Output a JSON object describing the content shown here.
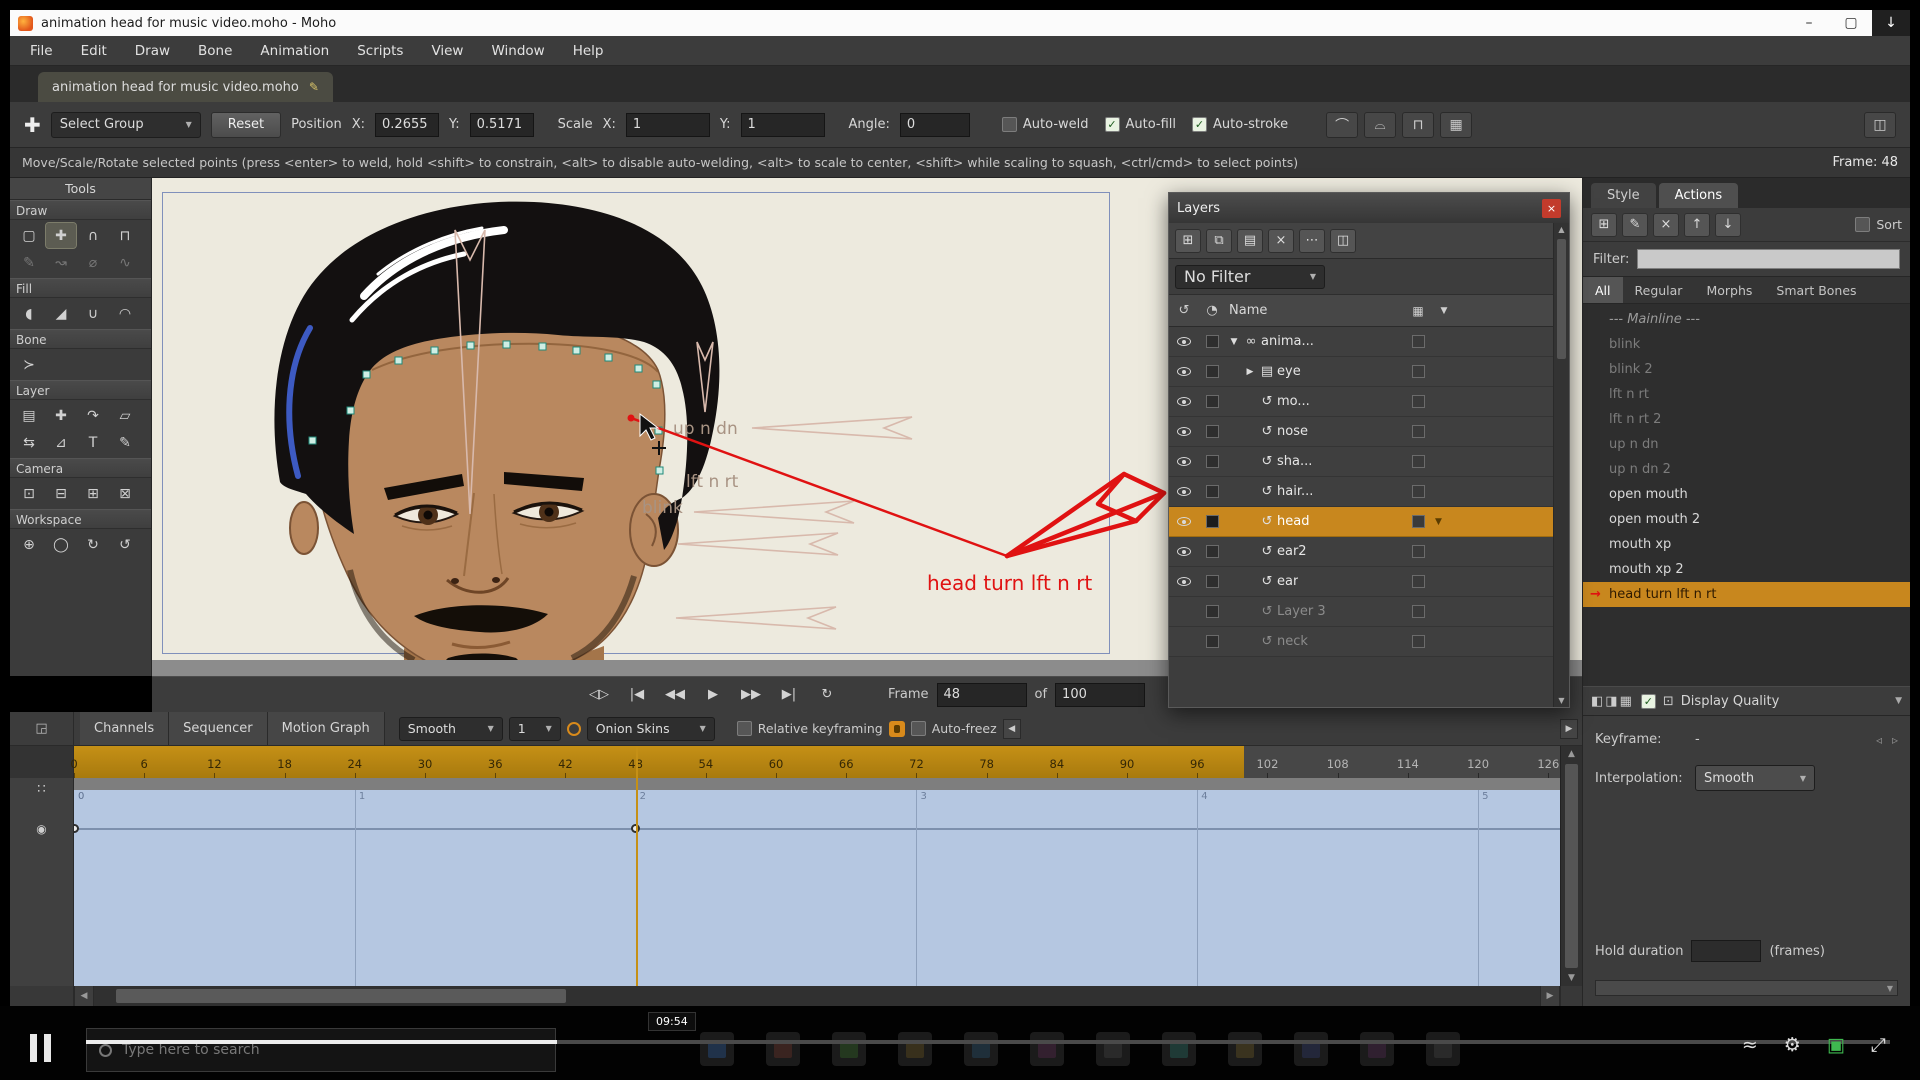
{
  "window": {
    "title": "animation head for music video.moho - Moho",
    "controls": {
      "minimize": "–",
      "maximize": "▢",
      "download": "↓"
    }
  },
  "colors": {
    "accent_orange": "#c8871e",
    "selection_red": "#e01212",
    "timeline_blue": "#b5c7e1",
    "canvas_cream": "#edeade"
  },
  "menu": {
    "items": [
      "File",
      "Edit",
      "Draw",
      "Bone",
      "Animation",
      "Scripts",
      "View",
      "Window",
      "Help"
    ]
  },
  "tab": {
    "label": "animation head for music video.moho",
    "edit_icon": "✎"
  },
  "toolbar": {
    "move_glyph": "✚",
    "select_group": "Select Group",
    "reset": "Reset",
    "position_label": "Position",
    "x_label": "X:",
    "y_label": "Y:",
    "position_x": "0.2655",
    "position_y": "0.5171",
    "scale_label": "Scale",
    "scale_x": "1",
    "scale_y": "1",
    "angle_label": "Angle:",
    "angle": "0",
    "checkboxes": [
      {
        "label": "Auto-weld",
        "checked": false
      },
      {
        "label": "Auto-fill",
        "checked": true
      },
      {
        "label": "Auto-stroke",
        "checked": true
      }
    ],
    "right_buttons": [
      {
        "name": "weld-arc-button",
        "glyph": "⌒"
      },
      {
        "name": "peak-smooth-button",
        "glyph": "⌓"
      },
      {
        "name": "flatten-button",
        "glyph": "⊓"
      },
      {
        "name": "grid-snap-button",
        "glyph": "▦"
      }
    ],
    "dual_view_glyph": "◫"
  },
  "status": {
    "hint": "Move/Scale/Rotate selected points (press <enter> to weld, hold <shift> to constrain, <alt> to disable auto-welding, <alt> to scale to center, <shift> while scaling to squash, <ctrl/cmd> to select points)",
    "frame": "Frame: 48"
  },
  "tools": {
    "title": "Tools",
    "sections": [
      {
        "label": "Draw",
        "icons": [
          {
            "name": "select-points-tool",
            "glyph": "▢"
          },
          {
            "name": "translate-points-tool",
            "glyph": "✚",
            "active": true
          },
          {
            "name": "magnet-tool",
            "glyph": "∩"
          },
          {
            "name": "magnet-width-tool",
            "glyph": "⊓"
          },
          {
            "name": "freehand-tool",
            "glyph": "✎",
            "dim": true
          },
          {
            "name": "curve-tool",
            "glyph": "↝",
            "dim": true
          },
          {
            "name": "delete-edge-tool",
            "glyph": "⌀",
            "dim": true
          },
          {
            "name": "noise-tool",
            "glyph": "∿",
            "dim": true
          }
        ]
      },
      {
        "label": "Fill",
        "icons": [
          {
            "name": "select-shape-tool",
            "glyph": "◖"
          },
          {
            "name": "create-shape-tool",
            "glyph": "◢"
          },
          {
            "name": "line-width-tool",
            "glyph": "∪"
          },
          {
            "name": "curvature-tool",
            "glyph": "◠"
          }
        ]
      },
      {
        "label": "Bone",
        "icons": [
          {
            "name": "select-bone-tool",
            "glyph": "≻"
          }
        ]
      },
      {
        "label": "Layer",
        "icons": [
          {
            "name": "layer-translate-tool",
            "glyph": "▤"
          },
          {
            "name": "layer-add-tool",
            "glyph": "✚"
          },
          {
            "name": "layer-rotate-tool",
            "glyph": "↷"
          },
          {
            "name": "layer-shear-tool",
            "glyph": "▱"
          },
          {
            "name": "layer-flip-tool",
            "glyph": "⇆"
          },
          {
            "name": "layer-scale-tool",
            "glyph": "⊿"
          },
          {
            "name": "text-tool",
            "glyph": "T"
          },
          {
            "name": "pen-tool",
            "glyph": "✎"
          }
        ]
      },
      {
        "label": "Camera",
        "icons": [
          {
            "name": "camera-track-tool",
            "glyph": "⊡"
          },
          {
            "name": "camera-zoom-tool",
            "glyph": "⊟"
          },
          {
            "name": "camera-roll-tool",
            "glyph": "⊞"
          },
          {
            "name": "camera-pan-tool",
            "glyph": "⊠"
          }
        ]
      },
      {
        "label": "Workspace",
        "icons": [
          {
            "name": "pan-tool",
            "glyph": "⊕"
          },
          {
            "name": "zoom-tool",
            "glyph": "◯"
          },
          {
            "name": "rotate-workspace-tool",
            "glyph": "↻"
          },
          {
            "name": "orbit-workspace-tool",
            "glyph": "↺"
          }
        ]
      }
    ]
  },
  "canvas": {
    "ghost_labels": {
      "up_n_dn": "up n dn",
      "lft_n_rt": "lft n rt",
      "blink": "blink"
    },
    "red_label": "head turn lft n rt"
  },
  "layers": {
    "title": "Layers",
    "close_glyph": "×",
    "toolbar": [
      {
        "name": "new-layer-button",
        "glyph": "⊞"
      },
      {
        "name": "duplicate-layer-button",
        "glyph": "⧉"
      },
      {
        "name": "new-group-button",
        "glyph": "▤"
      },
      {
        "name": "delete-layer-button",
        "glyph": "×"
      },
      {
        "name": "more-options-button",
        "glyph": "⋯"
      },
      {
        "name": "layer-comps-button",
        "glyph": "◫"
      }
    ],
    "filter": "No Filter",
    "header_icon_1": "↺",
    "header_icon_2": "◔",
    "name_header": "Name",
    "header_swatch_icon": "▦",
    "header_arrow": "▼",
    "rows": [
      {
        "name": "anima...",
        "type": "group",
        "expander": "▼",
        "icon": "∞",
        "indent": 0
      },
      {
        "name": "eye",
        "type": "folder",
        "expander": "▶",
        "icon": "▤",
        "indent": 1
      },
      {
        "name": "mo...",
        "type": "vector",
        "icon": "↺",
        "indent": 1
      },
      {
        "name": "nose",
        "type": "vector",
        "icon": "↺",
        "indent": 1
      },
      {
        "name": "sha...",
        "type": "vector",
        "icon": "↺",
        "indent": 1
      },
      {
        "name": "hair...",
        "type": "vector",
        "icon": "↺",
        "indent": 1
      },
      {
        "name": "head",
        "type": "vector",
        "icon": "↺",
        "indent": 1,
        "selected": true
      },
      {
        "name": "ear2",
        "type": "vector",
        "icon": "↺",
        "indent": 1
      },
      {
        "name": "ear",
        "type": "vector",
        "icon": "↺",
        "indent": 1
      },
      {
        "name": "Layer 3",
        "type": "vector",
        "icon": "↺",
        "indent": 1,
        "dim": true
      },
      {
        "name": "neck",
        "type": "vector",
        "icon": "↺",
        "indent": 1,
        "dim": true
      }
    ]
  },
  "actions": {
    "tabs": [
      "Style",
      "Actions"
    ],
    "active_tab": "Actions",
    "toolbar": [
      {
        "name": "new-action-button",
        "glyph": "⊞"
      },
      {
        "name": "rename-action-button",
        "glyph": "✎"
      },
      {
        "name": "delete-action-button",
        "glyph": "×"
      },
      {
        "name": "action-up-button",
        "glyph": "↑"
      },
      {
        "name": "action-down-button",
        "glyph": "↓"
      }
    ],
    "sort_label": "Sort",
    "filter_label": "Filter:",
    "subtabs": [
      "All",
      "Regular",
      "Morphs",
      "Smart Bones"
    ],
    "active_subtab": "All",
    "items": [
      {
        "label": "--- Mainline ---",
        "kind": "mainline"
      },
      {
        "label": "blink",
        "dim": true
      },
      {
        "label": "blink 2",
        "dim": true
      },
      {
        "label": "lft n rt",
        "dim": true
      },
      {
        "label": "lft n rt 2",
        "dim": true
      },
      {
        "label": "up n dn",
        "dim": true
      },
      {
        "label": "up n dn 2",
        "dim": true
      },
      {
        "label": "open mouth"
      },
      {
        "label": "open mouth 2"
      },
      {
        "label": "mouth xp"
      },
      {
        "label": "mouth xp 2"
      },
      {
        "label": "head turn lft n rt",
        "selected": true
      }
    ],
    "selected_arrow": "→"
  },
  "display_quality": {
    "icons": [
      {
        "name": "quality-wireframe-icon",
        "glyph": "◧"
      },
      {
        "name": "quality-split-icon",
        "glyph": "◨"
      },
      {
        "name": "quality-full-icon",
        "glyph": "▦"
      }
    ],
    "frame_icon": "⊡",
    "label": "Display Quality"
  },
  "keyframe": {
    "keyframe_label": "Keyframe:",
    "keyframe_value": "-",
    "nav_prev": "◃",
    "nav_next": "▹",
    "interpolation_label": "Interpolation:",
    "interpolation_value": "Smooth",
    "hold_label": "Hold duration",
    "hold_value": "",
    "hold_units": "(frames)"
  },
  "playback": {
    "buttons": [
      {
        "name": "cycle-button",
        "glyph": "◁▷"
      },
      {
        "name": "first-frame-button",
        "glyph": "|◀"
      },
      {
        "name": "prev-frame-button",
        "glyph": "◀◀"
      },
      {
        "name": "play-button",
        "glyph": "▶"
      },
      {
        "name": "next-frame-button",
        "glyph": "▶▶"
      },
      {
        "name": "last-frame-button",
        "glyph": "▶|"
      },
      {
        "name": "loop-button",
        "glyph": "↻"
      }
    ],
    "frame_label": "Frame",
    "frame_value": "48",
    "of_label": "of",
    "total_value": "100",
    "speaker_glyph": "◁)"
  },
  "timeline": {
    "corner_icon": "◲",
    "tabs": [
      "Channels",
      "Sequencer",
      "Motion Graph"
    ],
    "smooth": "Smooth",
    "cycles": "1",
    "onion_skins": "Onion Skins",
    "relative_keyframing": "Relative keyframing",
    "auto_freeze": "Auto-freez",
    "gutter_icon_1": "∷",
    "gutter_icon_2": "◉",
    "ticks": [
      0,
      6,
      12,
      18,
      24,
      30,
      36,
      42,
      48,
      54,
      60,
      66,
      72,
      78,
      84,
      90,
      96,
      102,
      108,
      114,
      120,
      126
    ],
    "seconds": [
      {
        "frame": 24,
        "label": "1"
      },
      {
        "frame": 48,
        "label": "2"
      },
      {
        "frame": 72,
        "label": "3"
      },
      {
        "frame": 96,
        "label": "4"
      },
      {
        "frame": 120,
        "label": "5"
      }
    ],
    "frames_visible": 127,
    "range_end": 100,
    "current_frame": 48,
    "keyframes": [
      0,
      48
    ],
    "zero_label": "0"
  },
  "taskbar": {
    "search_placeholder": "Type here to search",
    "video_time": "09:54",
    "right_icons": [
      {
        "name": "mini-player-icon",
        "glyph": "≈"
      },
      {
        "name": "settings-gear-icon",
        "glyph": "⚙"
      },
      {
        "name": "cast-icon",
        "glyph": "▣",
        "color": "#3fb950"
      },
      {
        "name": "fullscreen-icon",
        "glyph": "⤢"
      }
    ]
  }
}
